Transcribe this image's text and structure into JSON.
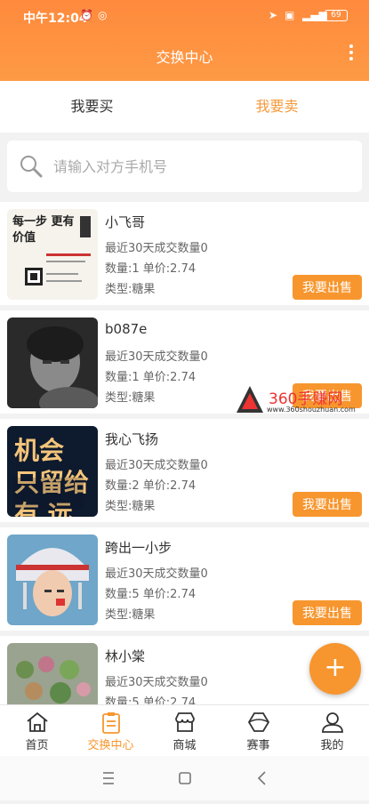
{
  "status_bar": {
    "time": "中午12:04",
    "battery": "69"
  },
  "header": {
    "title": "交换中心"
  },
  "tabs": [
    {
      "label": "我要买",
      "active": false
    },
    {
      "label": "我要卖",
      "active": true
    }
  ],
  "search": {
    "placeholder": "请输入对方手机号"
  },
  "listings": [
    {
      "name": "小飞哥",
      "recent": "最近30天成交数量0",
      "qty_price": "数量:1   单价:2.74",
      "type": "类型:糖果",
      "button": "我要出售",
      "thumb_text": "每一步 更有价值"
    },
    {
      "name": "b087e",
      "recent": "最近30天成交数量0",
      "qty_price": "数量:1   单价:2.74",
      "type": "类型:糖果",
      "button": "我要出售",
      "thumb_text": ""
    },
    {
      "name": "我心飞扬",
      "recent": "最近30天成交数量0",
      "qty_price": "数量:2   单价:2.74",
      "type": "类型:糖果",
      "button": "我要出售",
      "thumb_text": "机会 只留给有 远见的人"
    },
    {
      "name": "跨出一小步",
      "recent": "最近30天成交数量0",
      "qty_price": "数量:5   单价:2.74",
      "type": "类型:糖果",
      "button": "我要出售",
      "thumb_text": ""
    },
    {
      "name": "林小棠",
      "recent": "最近30天成交数量0",
      "qty_price": "数量:5   单价:2.74",
      "type": "",
      "button": "",
      "thumb_text": ""
    }
  ],
  "watermark": {
    "text": "360手赚网",
    "sub": "www.360shouzhuan.com"
  },
  "fab": {
    "label": "+"
  },
  "bottom_nav": [
    {
      "label": "首页",
      "icon": "home-icon",
      "active": false
    },
    {
      "label": "交换中心",
      "icon": "exchange-icon",
      "active": true
    },
    {
      "label": "商城",
      "icon": "shop-icon",
      "active": false
    },
    {
      "label": "赛事",
      "icon": "event-icon",
      "active": false
    },
    {
      "label": "我的",
      "icon": "profile-icon",
      "active": false
    }
  ],
  "colors": {
    "accent": "#f7962e",
    "header": "#ff8a3d"
  }
}
